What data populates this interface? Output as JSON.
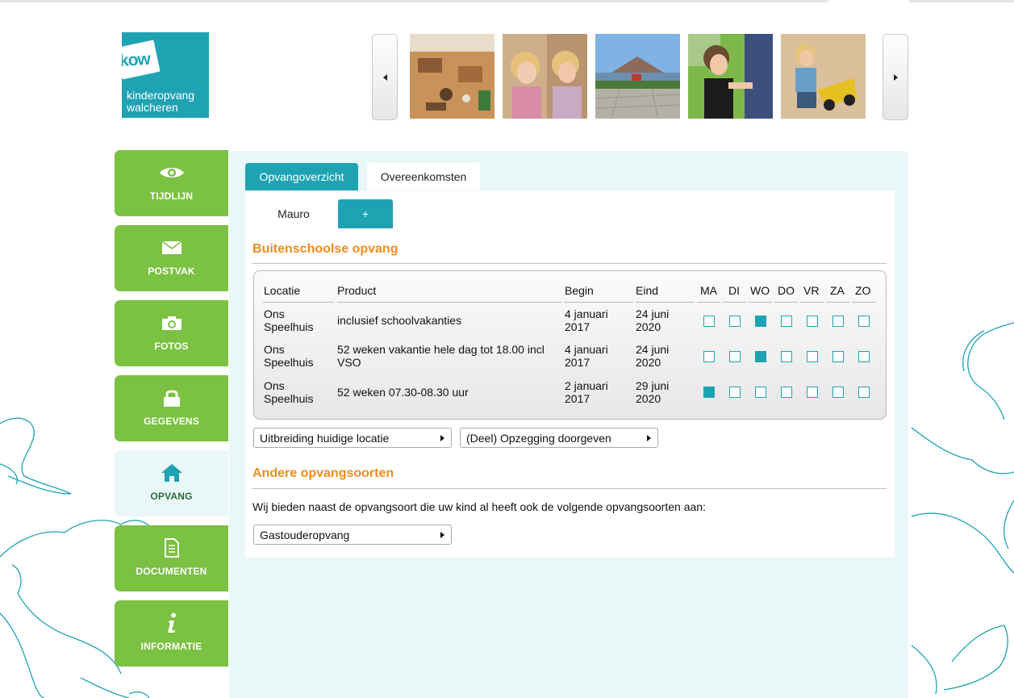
{
  "brand": {
    "logo_short": "kow",
    "logo_line1": "kinderopvang",
    "logo_line2": "walcheren",
    "color_primary": "#1fa3b3",
    "color_nav": "#7bc142",
    "color_heading": "#f28c1f"
  },
  "carousel": {
    "prev_icon": "triangle-left-icon",
    "next_icon": "triangle-right-icon",
    "photo_count": 5
  },
  "sidebar": {
    "items": [
      {
        "label": "TIJDLIJN",
        "icon": "eye-icon",
        "active": false
      },
      {
        "label": "POSTVAK",
        "icon": "envelope-icon",
        "active": false
      },
      {
        "label": "FOTOS",
        "icon": "camera-icon",
        "active": false
      },
      {
        "label": "GEGEVENS",
        "icon": "lock-icon",
        "active": false
      },
      {
        "label": "OPVANG",
        "icon": "home-icon",
        "active": true
      },
      {
        "label": "DOCUMENTEN",
        "icon": "document-icon",
        "active": false
      },
      {
        "label": "INFORMATIE",
        "icon": "info-icon",
        "active": false
      }
    ]
  },
  "tabs": {
    "overview": "Opvangoverzicht",
    "agreements": "Overeenkomsten"
  },
  "children": {
    "child_name": "Mauro",
    "add_label": "+"
  },
  "bso": {
    "title": "Buitenschoolse opvang",
    "headers": {
      "location": "Locatie",
      "product": "Product",
      "begin": "Begin",
      "end": "Eind",
      "days": [
        "MA",
        "DI",
        "WO",
        "DO",
        "VR",
        "ZA",
        "ZO"
      ]
    },
    "rows": [
      {
        "location_1": "Ons",
        "location_2": "Speelhuis",
        "product_1": "inclusief schoolvakanties",
        "product_2": "",
        "begin_1": "4 januari",
        "begin_2": "2017",
        "end_1": "24 juni",
        "end_2": "2020",
        "days": [
          false,
          false,
          true,
          false,
          false,
          false,
          false
        ]
      },
      {
        "location_1": "Ons",
        "location_2": "Speelhuis",
        "product_1": "52 weken vakantie hele dag tot 18.00 incl",
        "product_2": "VSO",
        "begin_1": "4 januari",
        "begin_2": "2017",
        "end_1": "24 juni",
        "end_2": "2020",
        "days": [
          false,
          false,
          true,
          false,
          false,
          false,
          false
        ]
      },
      {
        "location_1": "Ons",
        "location_2": "Speelhuis",
        "product_1": "52 weken 07.30-08.30 uur",
        "product_2": "",
        "begin_1": "2 januari",
        "begin_2": "2017",
        "end_1": "29 juni",
        "end_2": "2020",
        "days": [
          true,
          false,
          false,
          false,
          false,
          false,
          false
        ]
      }
    ],
    "btn_extend": "Uitbreiding huidige locatie",
    "btn_cancel": "(Deel) Opzegging doorgeven"
  },
  "other": {
    "title": "Andere opvangsoorten",
    "text": "Wij bieden naast de opvangsoort die uw kind al heeft ook de volgende opvangsoorten aan:",
    "btn_host": "Gastouderopvang"
  }
}
